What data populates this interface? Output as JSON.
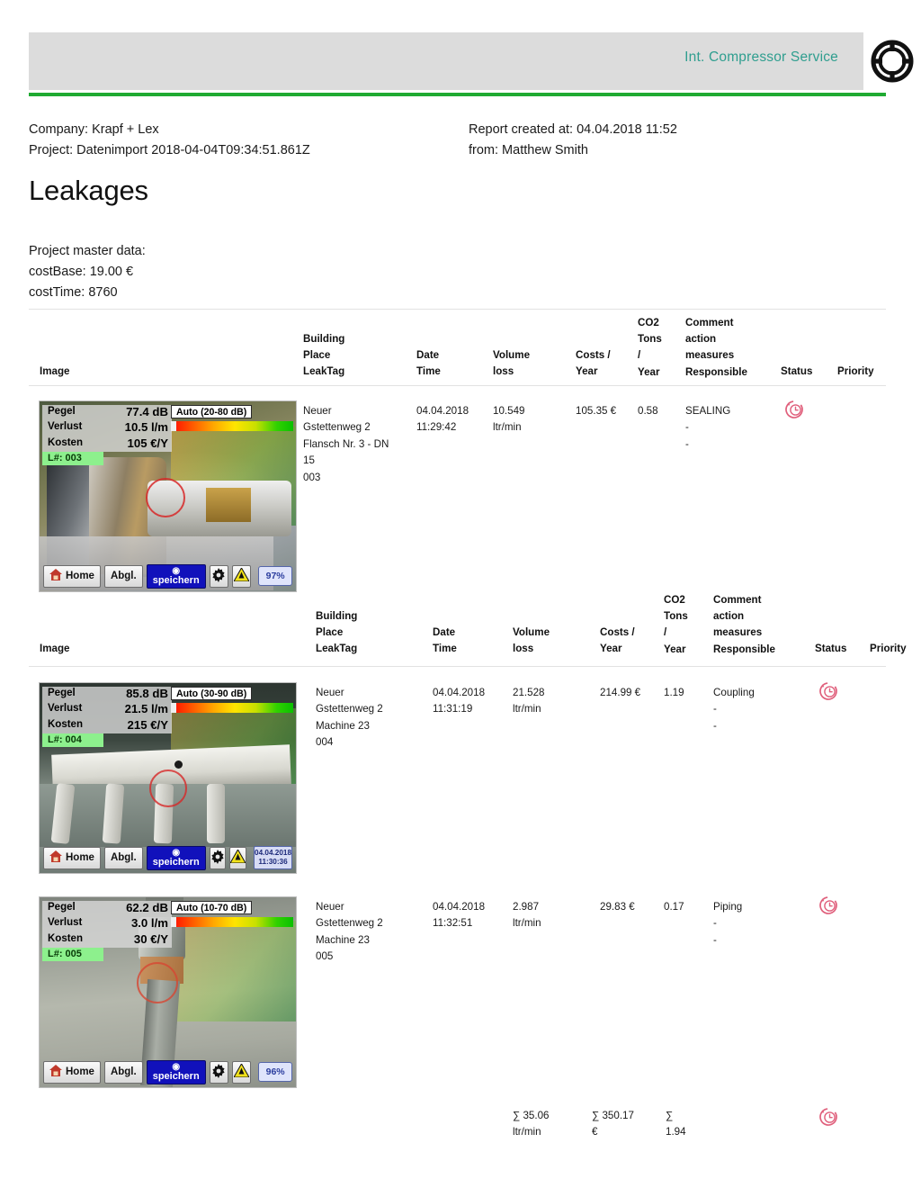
{
  "header": {
    "brand": "Int. Compressor Service",
    "logo_icon": "crosshair-target-icon",
    "accent_color": "#2f9e8f",
    "rule_color": "#1faa32",
    "band_color": "#dcdcdc"
  },
  "meta": {
    "company": "Company: Krapf + Lex",
    "project": "Project: Datenimport 2018-04-04T09:34:51.861Z",
    "created": "Report created at: 04.04.2018 11:52",
    "from": "from: Matthew Smith"
  },
  "title": "Leakages",
  "master": {
    "heading": "Project master data:",
    "cost_base": "costBase: 19.00 €",
    "cost_time": "costTime: 8760"
  },
  "columns": {
    "image": "Image",
    "building": "Building",
    "place": "Place",
    "leaktag": "LeakTag",
    "date": "Date",
    "time": "Time",
    "volume": "Volume",
    "loss": "loss",
    "costs": "Costs /",
    "costs_year": "Year",
    "co2": "CO2",
    "co2_tons": "Tons",
    "co2_slash": "/",
    "co2_year": "Year",
    "comment": "Comment",
    "action": "action",
    "measures": "measures",
    "responsible": "Responsible",
    "status": "Status",
    "priority": "Priority"
  },
  "rows": [
    {
      "device": {
        "pegel_label": "Pegel",
        "pegel_value": "77.4 dB",
        "verlust_label": "Verlust",
        "verlust_value": "10.5 l/m",
        "kosten_label": "Kosten",
        "kosten_value": "105 €/Y",
        "leaktag": "L#: 003",
        "auto_range": "Auto (20-80 dB)",
        "home": "Home",
        "abgl": "Abgl.",
        "save": "speichern",
        "battery": "97%",
        "timestamp_date": "",
        "timestamp_time": ""
      },
      "building": "Neuer",
      "place": "Gstettenweg 2",
      "leaktag_lines": [
        "Flansch Nr. 3 - DN",
        "15",
        "003"
      ],
      "date": "04.04.2018",
      "time": "11:29:42",
      "volume": "10.549",
      "volume_unit": "ltr/min",
      "costs": "105.35 €",
      "co2": "0.58",
      "comment": "SEALING",
      "action": "-",
      "measures": "-",
      "status_icon": "history-clock-icon",
      "priority": ""
    },
    {
      "device": {
        "pegel_label": "Pegel",
        "pegel_value": "85.8 dB",
        "verlust_label": "Verlust",
        "verlust_value": "21.5 l/m",
        "kosten_label": "Kosten",
        "kosten_value": "215 €/Y",
        "leaktag": "L#: 004",
        "auto_range": "Auto (30-90 dB)",
        "home": "Home",
        "abgl": "Abgl.",
        "save": "speichern",
        "battery": "",
        "timestamp_date": "04.04.2018",
        "timestamp_time": "11:30:36"
      },
      "building": "Neuer",
      "place": "Gstettenweg 2",
      "leaktag_lines": [
        "Machine 23",
        "004"
      ],
      "date": "04.04.2018",
      "time": "11:31:19",
      "volume": "21.528",
      "volume_unit": "ltr/min",
      "costs": "214.99 €",
      "co2": "1.19",
      "comment": "Coupling",
      "action": "-",
      "measures": "-",
      "status_icon": "history-clock-icon",
      "priority": ""
    },
    {
      "device": {
        "pegel_label": "Pegel",
        "pegel_value": "62.2 dB",
        "verlust_label": "Verlust",
        "verlust_value": "3.0 l/m",
        "kosten_label": "Kosten",
        "kosten_value": "30 €/Y",
        "leaktag": "L#: 005",
        "auto_range": "Auto (10-70 dB)",
        "home": "Home",
        "abgl": "Abgl.",
        "save": "speichern",
        "battery": "96%",
        "timestamp_date": "",
        "timestamp_time": ""
      },
      "building": "Neuer",
      "place": "Gstettenweg 2",
      "leaktag_lines": [
        "Machine 23",
        "005"
      ],
      "date": "04.04.2018",
      "time": "11:32:51",
      "volume": "2.987",
      "volume_unit": "ltr/min",
      "costs": "29.83 €",
      "co2": "0.17",
      "comment": "Piping",
      "action": "-",
      "measures": "-",
      "status_icon": "history-clock-icon",
      "priority": ""
    }
  ],
  "totals": {
    "volume": "∑ 35.06",
    "volume_unit": "ltr/min",
    "costs": "∑ 350.17",
    "costs_unit": "€",
    "co2_sum": "∑",
    "co2_value": "1.94",
    "status_icon": "history-clock-icon"
  }
}
